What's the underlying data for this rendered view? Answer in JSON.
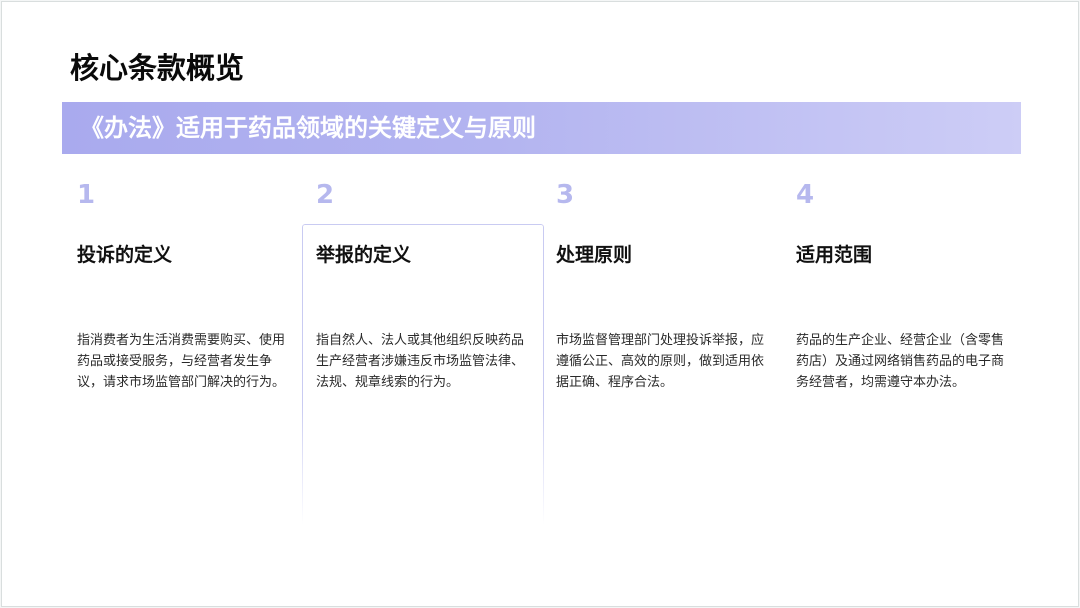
{
  "slide": {
    "title": "核心条款概览",
    "banner": "《办法》适用于药品领域的关键定义与原则"
  },
  "cards": [
    {
      "number": "1",
      "title": "投诉的定义",
      "description": "指消费者为生活消费需要购买、使用药品或接受服务，与经营者发生争议，请求市场监管部门解决的行为。"
    },
    {
      "number": "2",
      "title": "举报的定义",
      "description": "指自然人、法人或其他组织反映药品生产经营者涉嫌违反市场监管法律、法规、规章线索的行为。"
    },
    {
      "number": "3",
      "title": "处理原则",
      "description": "市场监督管理部门处理投诉举报，应遵循公正、高效的原则，做到适用依据正确、程序合法。"
    },
    {
      "number": "4",
      "title": "适用范围",
      "description": "药品的生产企业、经营企业（含零售药店）及通过网络销售药品的电子商务经营者，均需遵守本办法。"
    }
  ],
  "colors": {
    "accent": "#b3b4f0",
    "number": "#b6b8ee",
    "title_text": "#0a0a0a"
  }
}
